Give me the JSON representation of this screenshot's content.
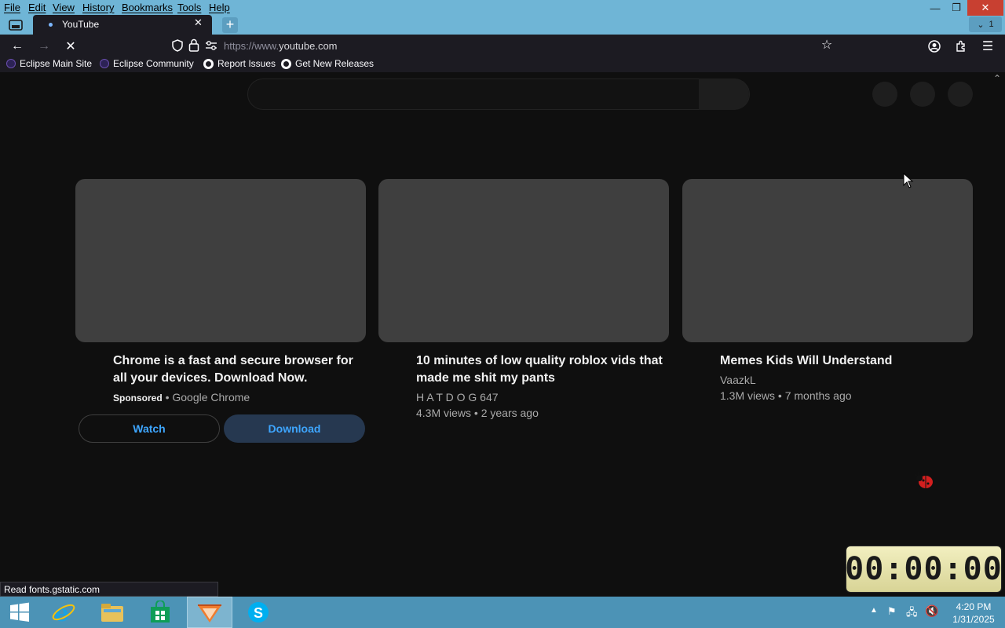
{
  "menu": [
    "File",
    "Edit",
    "View",
    "History",
    "Bookmarks",
    "Tools",
    "Help"
  ],
  "tab": {
    "title": "YouTube",
    "close": "✕"
  },
  "tab_list_count": "1",
  "url": {
    "scheme": "https://www.",
    "host": "youtube.com"
  },
  "bookmarks": [
    {
      "label": "Eclipse Main Site",
      "icon": "eclipse-icon"
    },
    {
      "label": "Eclipse Community",
      "icon": "eclipse-icon"
    },
    {
      "label": "Report Issues",
      "icon": "github-icon"
    },
    {
      "label": "Get New Releases",
      "icon": "github-icon"
    }
  ],
  "videos": [
    {
      "title_line1": "Chrome is a fast and secure browser for",
      "title_line2": "all your devices. Download Now.",
      "sponsored": "Sponsored",
      "channel": "Google Chrome"
    },
    {
      "title_line1": "10 minutes of low quality roblox vids that",
      "title_line2": "made me shit my pants",
      "channel": "H A T D O G 647",
      "meta": "4.3M views • 2 years ago"
    },
    {
      "title_line1": "Memes Kids Will Understand",
      "channel": "VaazkL",
      "meta": "1.3M views • 7 months ago"
    }
  ],
  "ad_buttons": {
    "watch": "Watch",
    "download": "Download"
  },
  "status_text": "Read fonts.gstatic.com",
  "clock": "00:00:00",
  "tray": {
    "time": "4:20 PM",
    "date": "1/31/2025"
  },
  "colors": {
    "accent_link": "#3ea6ff",
    "taskbar": "#4c93b6",
    "titlebar": "#6fb5d6"
  }
}
